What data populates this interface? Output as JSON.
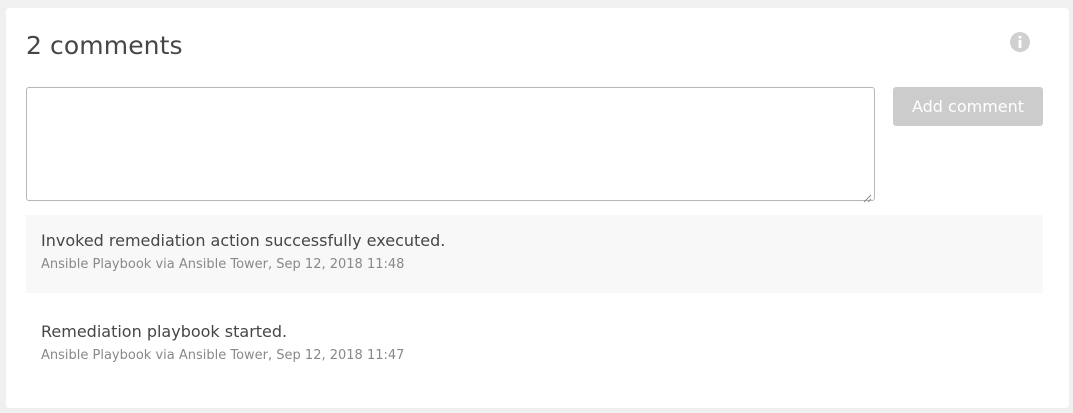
{
  "comments_panel": {
    "title": "2 comments",
    "info_icon": "info-circle-icon",
    "input": {
      "value": "",
      "placeholder": ""
    },
    "add_button_label": "Add comment",
    "add_button_enabled": false,
    "colors": {
      "button_disabled": "#cccccc",
      "text": "#454646",
      "meta_text": "#898989",
      "shaded_row": "#f8f8f8"
    },
    "comments": [
      {
        "text": "Invoked remediation action successfully executed.",
        "meta": "Ansible Playbook via Ansible Tower, Sep 12, 2018 11:48"
      },
      {
        "text": "Remediation playbook started.",
        "meta": "Ansible Playbook via Ansible Tower, Sep 12, 2018 11:47"
      }
    ]
  }
}
